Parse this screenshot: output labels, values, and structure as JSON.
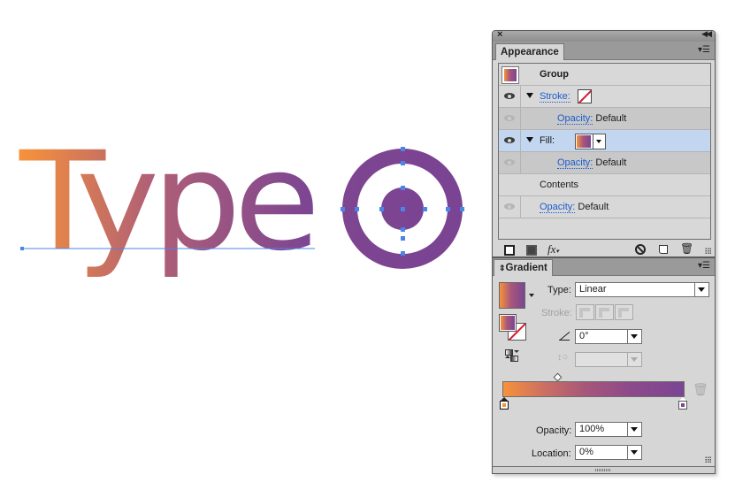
{
  "artwork": {
    "text": "Type",
    "gradient": {
      "start": "#f7923a",
      "mid": "#a8577a",
      "end": "#7b4593"
    },
    "selection_color": "#4a86e8",
    "target_fill": "#7b4593"
  },
  "appearance_panel": {
    "tab": "Appearance",
    "rows": [
      {
        "label": "Group"
      },
      {
        "label": "Stroke:"
      },
      {
        "label": "Opacity:",
        "value": "Default"
      },
      {
        "label": "Fill:"
      },
      {
        "label": "Opacity:",
        "value": "Default"
      },
      {
        "label": "Contents"
      },
      {
        "label": "Opacity:",
        "value": "Default"
      }
    ],
    "footer": {
      "add_stroke": "add-new-stroke",
      "add_fill": "add-new-fill",
      "fx": "fx",
      "clear": "clear-appearance",
      "duplicate": "duplicate-item",
      "delete": "delete-item"
    }
  },
  "gradient_panel": {
    "tab": "Gradient",
    "type_label": "Type:",
    "type_value": "Linear",
    "stroke_label": "Stroke:",
    "angle_value": "0°",
    "aspect_value": "",
    "opacity_label": "Opacity:",
    "opacity_value": "100%",
    "location_label": "Location:",
    "location_value": "0%",
    "stops": [
      {
        "color": "#f7923a",
        "location": 0,
        "selected": true
      },
      {
        "color": "#7b4593",
        "location": 100,
        "selected": false
      }
    ],
    "midpoint_location": 30
  }
}
